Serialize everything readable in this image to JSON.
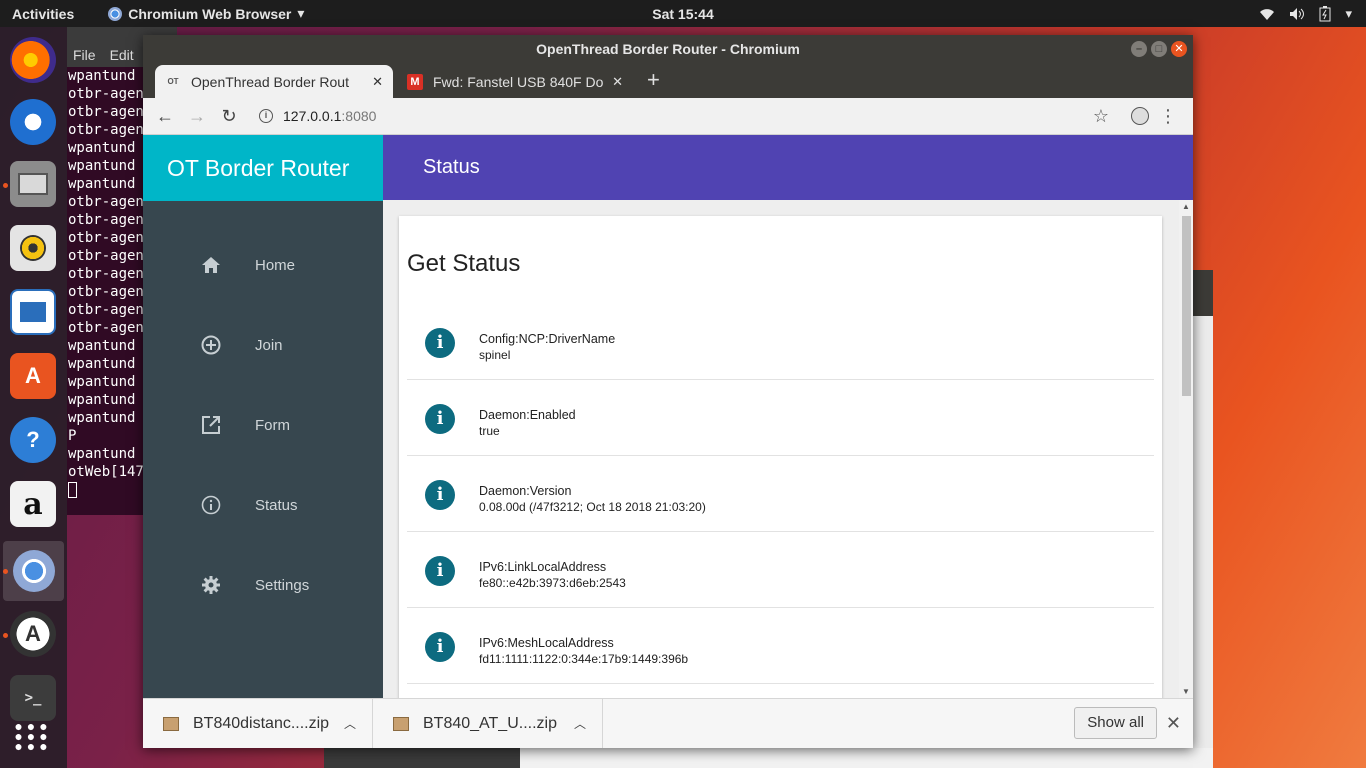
{
  "topbar": {
    "activities": "Activities",
    "app_name": "Chromium Web Browser",
    "clock": "Sat 15:44"
  },
  "dock": {
    "items": [
      "firefox-icon",
      "thunderbird-icon",
      "files-icon",
      "rhythmbox-icon",
      "writer-icon",
      "software-center-icon",
      "help-icon",
      "amazon-icon",
      "chromium-icon",
      "updater-icon",
      "terminal-icon",
      "app-grid-icon"
    ]
  },
  "terminal": {
    "menu": [
      "File",
      "Edit"
    ],
    "lines": [
      "wpantund",
      "otbr-agen",
      "otbr-agen",
      "otbr-agen",
      "wpantund",
      "wpantund",
      "wpantund",
      "otbr-agen",
      "otbr-agen",
      "otbr-agen",
      "otbr-agen",
      "otbr-agen",
      "otbr-agen",
      "otbr-agen",
      "otbr-agen",
      "wpantund",
      "wpantund",
      "wpantund",
      "wpantund",
      "wpantund",
      "P",
      "wpantund",
      "otWeb[147"
    ]
  },
  "browser": {
    "window_title": "OpenThread Border Router - Chromium",
    "tabs": [
      {
        "favicon": "OT",
        "title": "OpenThread Border Rout"
      },
      {
        "favicon": "M",
        "title": "Fwd: Fanstel USB 840F Do"
      }
    ],
    "url_host": "127.0.0.1",
    "url_port": ":8080"
  },
  "page": {
    "brand": "OT Border Router",
    "header_title": "Status",
    "nav": [
      {
        "icon": "home-icon",
        "label": "Home"
      },
      {
        "icon": "add-circle-icon",
        "label": "Join"
      },
      {
        "icon": "open-in-new-icon",
        "label": "Form"
      },
      {
        "icon": "info-outline-icon",
        "label": "Status"
      },
      {
        "icon": "settings-icon",
        "label": "Settings"
      }
    ],
    "card_title": "Get Status",
    "rows": [
      {
        "key": "Config:NCP:DriverName",
        "value": "spinel"
      },
      {
        "key": "Daemon:Enabled",
        "value": "true"
      },
      {
        "key": "Daemon:Version",
        "value": "0.08.00d (/47f3212; Oct 18 2018 21:03:20)"
      },
      {
        "key": "IPv6:LinkLocalAddress",
        "value": "fe80::e42b:3973:d6eb:2543"
      },
      {
        "key": "IPv6:MeshLocalAddress",
        "value": "fd11:1111:1122:0:344e:17b9:1449:396b"
      }
    ]
  },
  "downloads": {
    "items": [
      {
        "name": "BT840distanc....zip"
      },
      {
        "name": "BT840_AT_U....zip"
      }
    ],
    "show_all": "Show all"
  },
  "colors": {
    "brand_bg": "#00b6c8",
    "appbar_bg": "#5043b2",
    "sidenav_bg": "#37474f",
    "info_icon": "#0d6b80",
    "ubuntu_orange": "#e95420"
  }
}
